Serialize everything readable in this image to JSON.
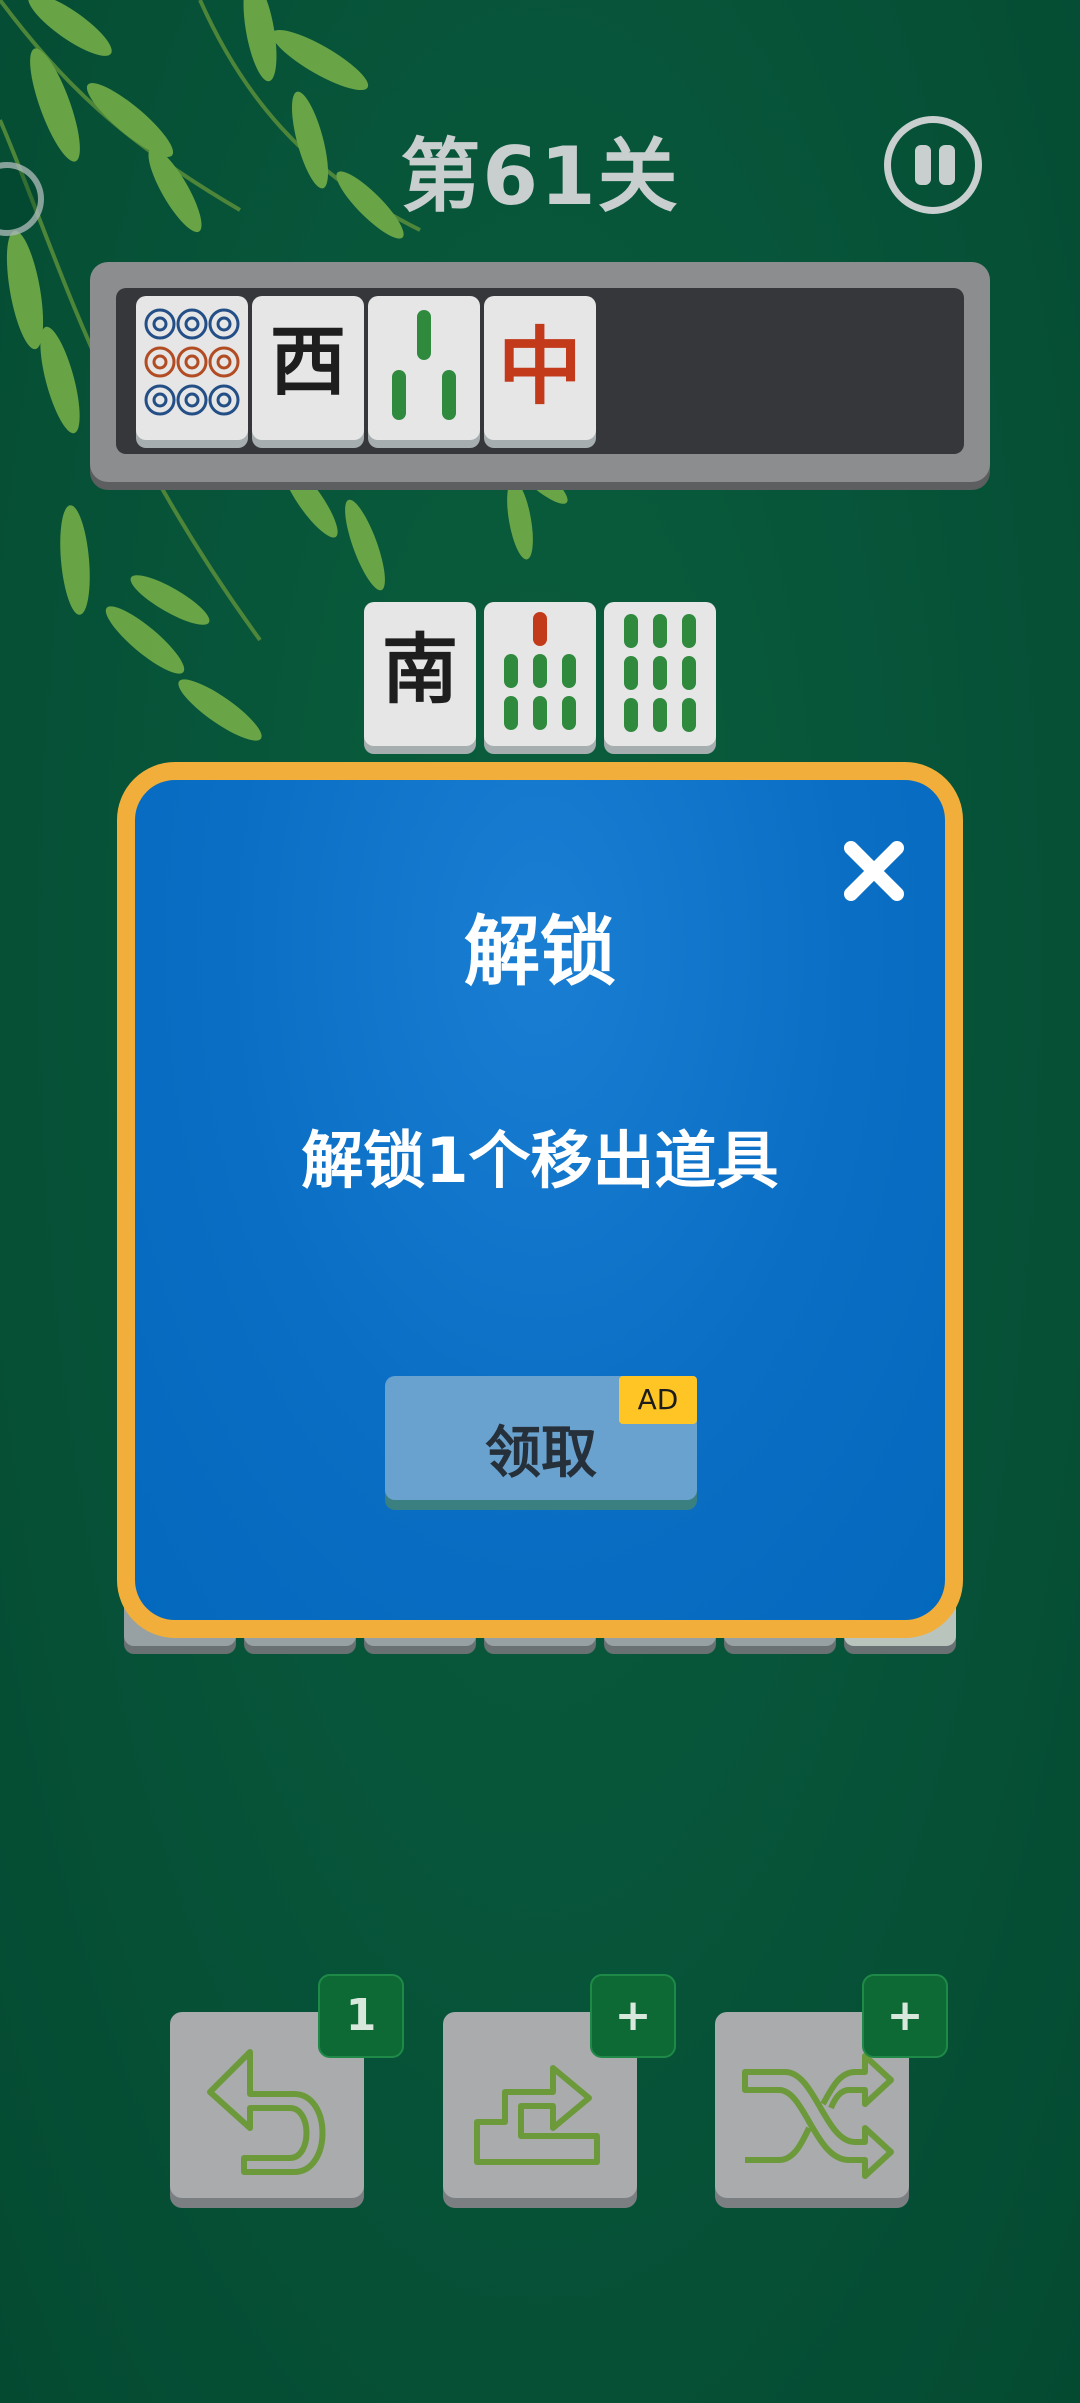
{
  "level_title": "第61关",
  "tray_tiles": [
    {
      "name": "circles-9-tile"
    },
    {
      "name": "west-wind-tile",
      "text": "西"
    },
    {
      "name": "bamboo-3-tile"
    },
    {
      "name": "red-dragon-tile",
      "text": "中"
    }
  ],
  "board_tiles": [
    {
      "name": "south-wind-tile",
      "text": "南"
    },
    {
      "name": "bamboo-7-tile"
    },
    {
      "name": "bamboo-9-tile"
    }
  ],
  "modal": {
    "title": "解锁",
    "message": "解锁1个移出道具",
    "claim_label": "领取",
    "ad_badge": "AD"
  },
  "tools": [
    {
      "name": "undo",
      "icon": "undo-arrow-icon",
      "badge": "1"
    },
    {
      "name": "move-out",
      "icon": "move-out-arrow-icon",
      "badge": "+"
    },
    {
      "name": "shuffle",
      "icon": "shuffle-arrows-icon",
      "badge": "+"
    }
  ],
  "colors": {
    "background": "#07553a",
    "modal_fill": "#0a6ec4",
    "modal_border": "#f2ae3a",
    "ad_badge": "#ffc524",
    "tool_badge": "#0e6a34"
  }
}
